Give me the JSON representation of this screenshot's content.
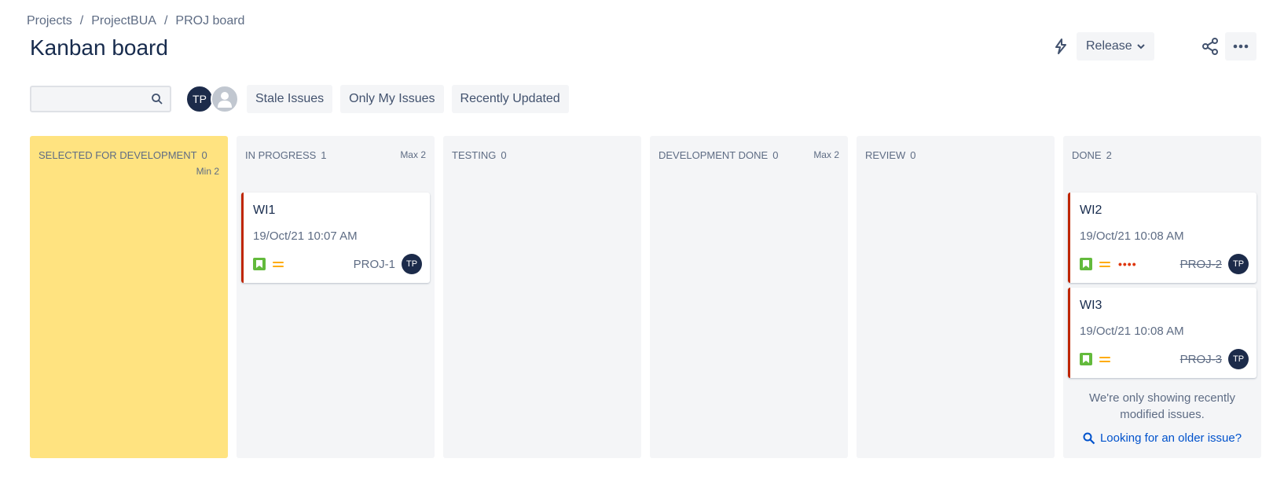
{
  "breadcrumb": {
    "items": [
      "Projects",
      "ProjectBUA",
      "PROJ board"
    ],
    "separator": "/"
  },
  "page": {
    "title": "Kanban board"
  },
  "actions": {
    "release_label": "Release"
  },
  "search": {
    "value": "",
    "placeholder": ""
  },
  "avatars": [
    {
      "initials": "TP"
    },
    {
      "initials": ""
    }
  ],
  "filters": [
    "Stale Issues",
    "Only My Issues",
    "Recently Updated"
  ],
  "columns": [
    {
      "name": "SELECTED FOR DEVELOPMENT",
      "count": "0",
      "limit": "",
      "min": "Min 2"
    },
    {
      "name": "IN PROGRESS",
      "count": "1",
      "limit": "Max 2",
      "min": ""
    },
    {
      "name": "TESTING",
      "count": "0",
      "limit": "",
      "min": ""
    },
    {
      "name": "DEVELOPMENT DONE",
      "count": "0",
      "limit": "Max 2",
      "min": ""
    },
    {
      "name": "REVIEW",
      "count": "0",
      "limit": "",
      "min": ""
    },
    {
      "name": "DONE",
      "count": "2",
      "limit": "",
      "min": ""
    }
  ],
  "cards": [
    {
      "title": "WI1",
      "date": "19/Oct/21 10:07 AM",
      "key": "PROJ-1",
      "assignee": "TP",
      "dots": ""
    },
    {
      "title": "WI2",
      "date": "19/Oct/21 10:08 AM",
      "key": "PROJ-2",
      "assignee": "TP",
      "dots": "••••"
    },
    {
      "title": "WI3",
      "date": "19/Oct/21 10:08 AM",
      "key": "PROJ-3",
      "assignee": "TP",
      "dots": ""
    }
  ],
  "done_note": {
    "message": "We're only showing recently modified issues.",
    "link": "Looking for an older issue?"
  },
  "colors": {
    "highlight_column": "#ffe380",
    "card_border": "#bf2600",
    "story": "#63ba3c",
    "priority": "#ffab00",
    "avatar": "#1c2b4a"
  },
  "icons": [
    "search-icon",
    "bolt-icon",
    "chevron-down-icon",
    "share-icon",
    "more-icon",
    "story-icon",
    "priority-medium-icon",
    "magnifier-icon"
  ]
}
